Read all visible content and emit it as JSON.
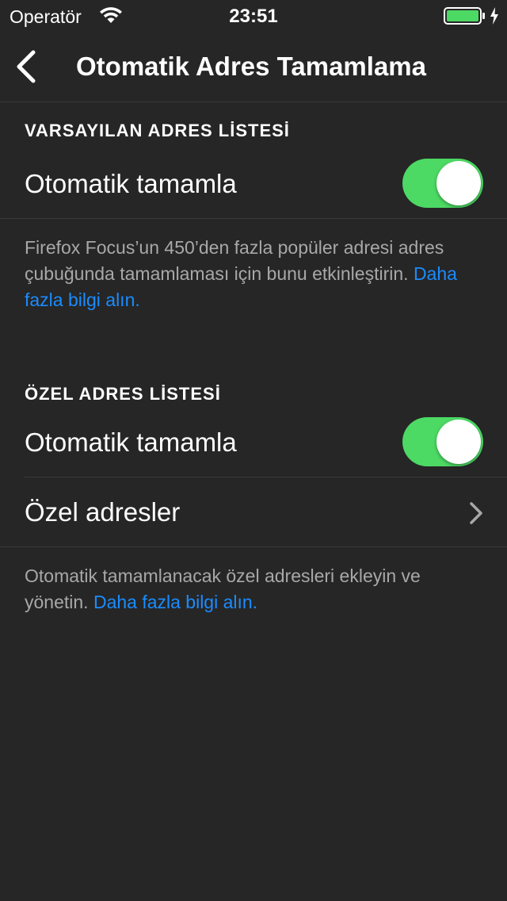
{
  "status_bar": {
    "carrier": "Operatör",
    "time": "23:51",
    "battery_color": "#4cd964"
  },
  "nav": {
    "title": "Otomatik Adres Tamamlama",
    "back_icon": "chevron-left-icon"
  },
  "default_section": {
    "header": "VARSAYILAN ADRES LİSTESİ",
    "autocomplete_label": "Otomatik tamamla",
    "autocomplete_enabled": true,
    "footer_text": "Firefox Focus’un 450’den fazla popüler adresi adres çubuğunda tamamlaması için bunu etkinleştirin. ",
    "footer_link": "Daha fazla bilgi alın."
  },
  "custom_section": {
    "header": "ÖZEL ADRES LİSTESİ",
    "autocomplete_label": "Otomatik tamamla",
    "autocomplete_enabled": true,
    "custom_urls_label": "Özel adresler",
    "footer_text": "Otomatik tamamlanacak özel adresleri ekleyin ve yönetin. ",
    "footer_link": "Daha fazla bilgi alın."
  },
  "colors": {
    "background": "#262626",
    "toggle_on": "#4cd964",
    "link": "#1a8cff",
    "secondary_text": "#a8a8a8"
  }
}
